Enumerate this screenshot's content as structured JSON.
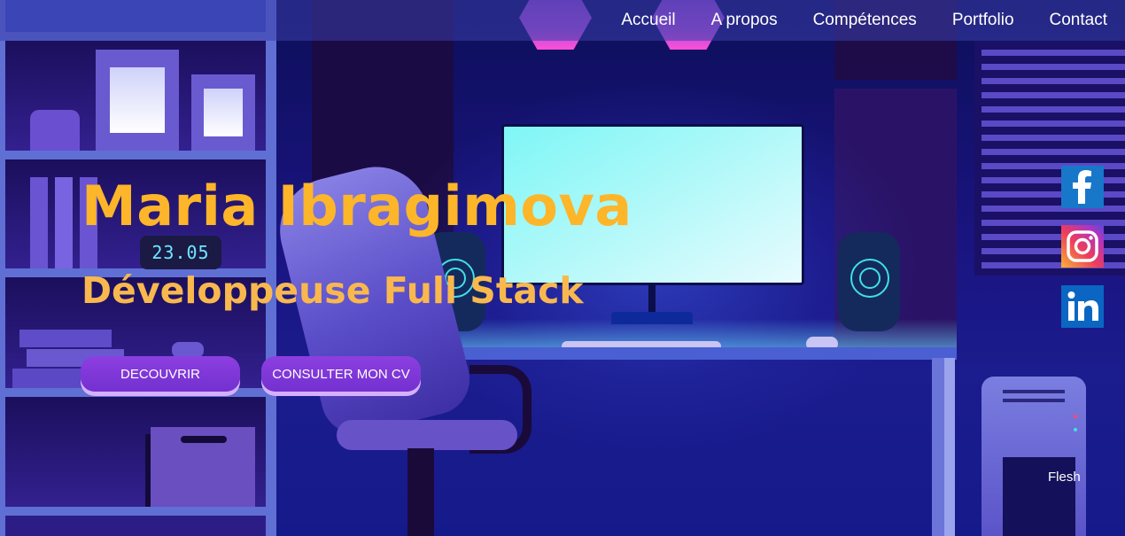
{
  "nav": {
    "items": [
      "Accueil",
      "A propos",
      "Compétences",
      "Portfolio",
      "Contact"
    ]
  },
  "hero": {
    "name": "Maria Ibragimova",
    "role": "Développeuse Full Stack",
    "discover_label": "DECOUVRIR",
    "cv_label": "CONSULTER MON CV"
  },
  "clock": {
    "time": "23.05"
  },
  "social": {
    "icons": [
      "facebook-icon",
      "instagram-icon",
      "linkedin-icon"
    ]
  },
  "footer_note": "Flesh",
  "colors": {
    "accent_yellow": "#fdb52a",
    "button_purple": "#7c35d6",
    "background_navy": "#1b1c8e"
  }
}
